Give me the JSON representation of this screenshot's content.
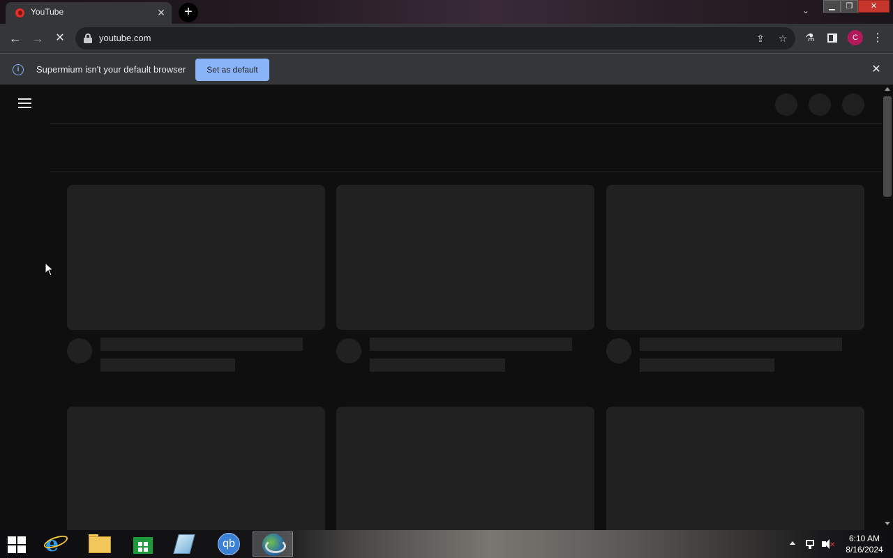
{
  "tab": {
    "title": "YouTube",
    "close_glyph": "✕",
    "new_tab_glyph": "+",
    "dropdown_glyph": "⌄"
  },
  "window": {
    "minimize_glyph": "▁",
    "maximize_glyph": "❐",
    "close_glyph": "✕"
  },
  "toolbar": {
    "back_glyph": "←",
    "forward_glyph": "→",
    "stop_glyph": "✕",
    "url": "youtube.com",
    "share_glyph": "⇪",
    "star_glyph": "☆",
    "labs_glyph": "⚗",
    "avatar_letter": "C",
    "menu_glyph": "⋮"
  },
  "infobar": {
    "info_glyph": "i",
    "message": "Supermium isn't your default browser",
    "button_label": "Set as default",
    "close_glyph": "✕"
  },
  "taskbar": {
    "qb_label": "qb",
    "time": "6:10 AM",
    "date": "8/16/2024"
  },
  "colors": {
    "accent": "#8ab4f8",
    "avatar": "#b4195a",
    "placeholder": "#212121",
    "page_background": "#0f0f0f"
  }
}
